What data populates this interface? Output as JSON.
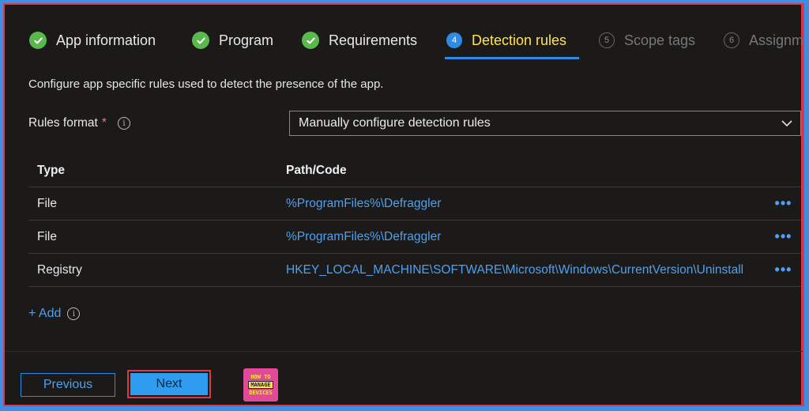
{
  "steps": [
    {
      "label": "App information",
      "state": "done"
    },
    {
      "label": "Program",
      "state": "done"
    },
    {
      "label": "Requirements",
      "state": "done"
    },
    {
      "number": "4",
      "label": "Detection rules",
      "state": "active"
    },
    {
      "number": "5",
      "label": "Scope tags",
      "state": "future"
    },
    {
      "number": "6",
      "label": "Assignm",
      "state": "future"
    }
  ],
  "description": "Configure app specific rules used to detect the presence of the app.",
  "rules_format": {
    "label": "Rules format",
    "required_marker": "*",
    "selected": "Manually configure detection rules"
  },
  "table": {
    "headers": [
      "Type",
      "Path/Code"
    ],
    "rows": [
      {
        "type": "File",
        "path": "%ProgramFiles%\\Defraggler"
      },
      {
        "type": "File",
        "path": "%ProgramFiles%\\Defraggler"
      },
      {
        "type": "Registry",
        "path": "HKEY_LOCAL_MACHINE\\SOFTWARE\\Microsoft\\Windows\\CurrentVersion\\Uninstall"
      }
    ],
    "more_label": "•••"
  },
  "add_label": "+ Add",
  "info_glyph": "i",
  "buttons": {
    "previous": "Previous",
    "next": "Next"
  },
  "logo": {
    "line1": "HOW TO",
    "line2": "MANAGE",
    "line3": "DEVICES"
  },
  "colors": {
    "accent": "#2f8ae6",
    "active_step": "#ffe54a",
    "done": "#5bb84d",
    "link": "#4fa0ef"
  }
}
